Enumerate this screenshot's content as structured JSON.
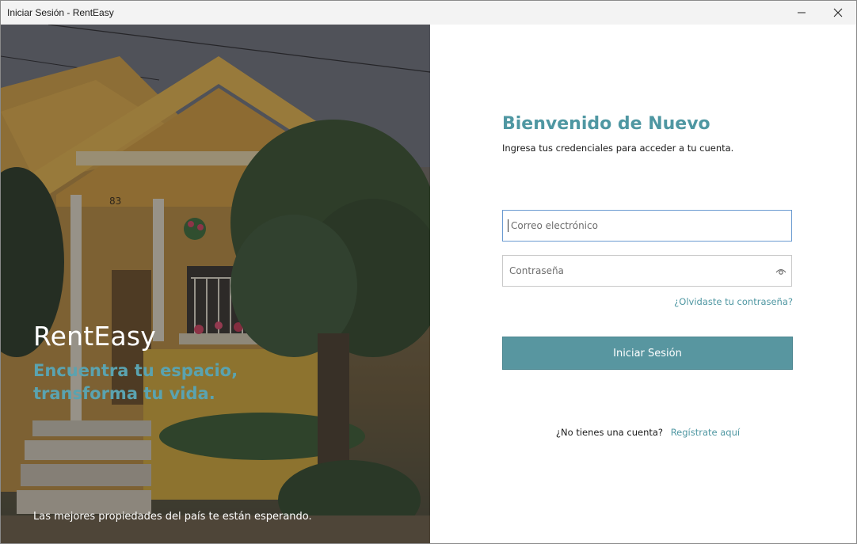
{
  "window": {
    "title": "Iniciar Sesión - RentEasy"
  },
  "hero": {
    "brand": "RentEasy",
    "tagline": "Encuentra tu espacio, transforma tu vida.",
    "house_number": "83",
    "footnote": "Las mejores propiedades del país te están esperando."
  },
  "form": {
    "heading": "Bienvenido de Nuevo",
    "subtitle": "Ingresa tus credenciales para acceder a tu cuenta.",
    "email_placeholder": "Correo electrónico",
    "password_placeholder": "Contraseña",
    "forgot_link": "¿Olvidaste tu contraseña?",
    "submit_label": "Iniciar Sesión",
    "no_account_text": "¿No tienes una cuenta?",
    "register_link": "Regístrate aquí"
  },
  "colors": {
    "accent": "#5896a0",
    "accent_text": "#4f97a2",
    "tagline": "#5aa3b0"
  },
  "icons": {
    "minimize": "minimize-icon",
    "close": "close-icon",
    "password_toggle": "eye-icon"
  }
}
